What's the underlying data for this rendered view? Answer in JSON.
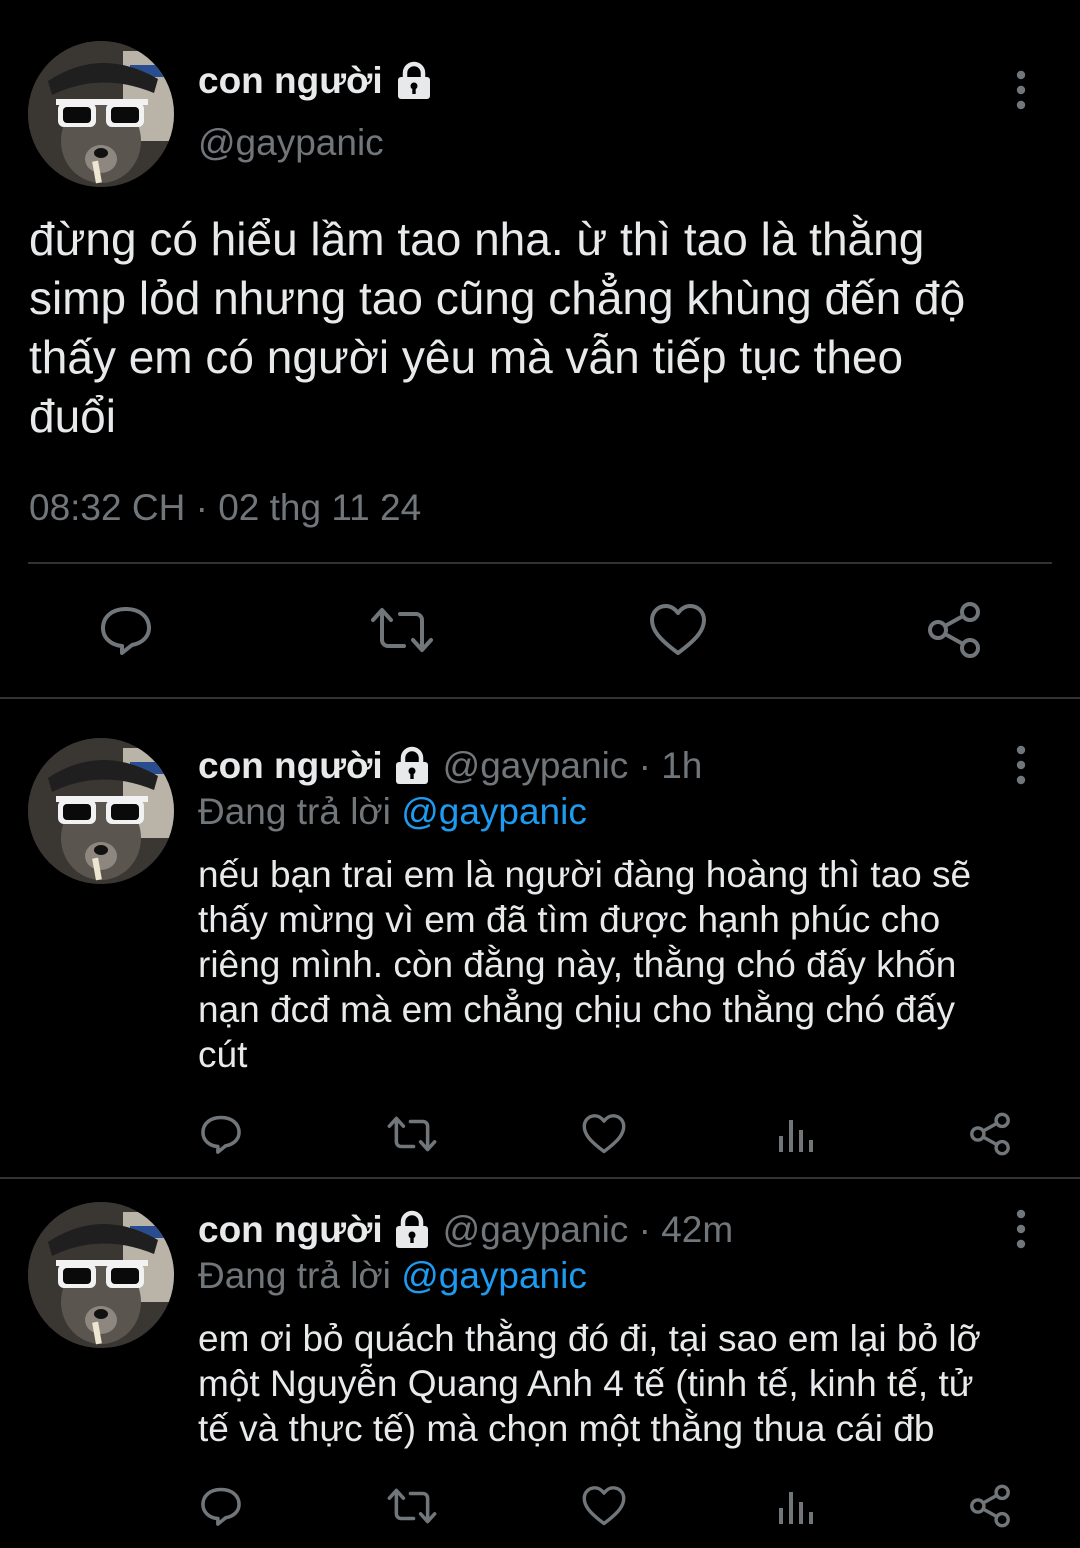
{
  "main_tweet": {
    "author_name": "con người",
    "handle": "@gaypanic",
    "text": "đừng có hiểu lầm tao nha. ừ thì tao là thằng\nsimp lỏd nhưng tao cũng chẳng khùng đến độ\nthấy em có người yêu mà vẫn tiếp tục theo\nđuổi",
    "timestamp": "08:32 CH · 02 thg 11 24",
    "icons": {
      "lock": "lock-icon",
      "more": "more-vertical-icon",
      "reply": "reply-icon",
      "retweet": "retweet-icon",
      "like": "heart-icon",
      "share": "share-icon"
    }
  },
  "replies": [
    {
      "author_name": "con người",
      "handle": "@gaypanic",
      "time_ago": "1h",
      "replying_label": "Đang trả lời",
      "replying_to": "@gaypanic",
      "text": "nếu bạn trai em là người đàng hoàng thì tao sẽ\nthấy mừng vì em đã tìm được hạnh phúc cho\nriêng mình. còn đằng này, thằng chó đấy khốn\nnạn đcđ mà em chẳng chịu cho thằng chó đấy\ncút"
    },
    {
      "author_name": "con người",
      "handle": "@gaypanic",
      "time_ago": "42m",
      "replying_label": "Đang trả lời",
      "replying_to": "@gaypanic",
      "text": "em ơi bỏ quách thằng đó đi, tại sao em lại bỏ lỡ\nmột Nguyễn Quang Anh 4 tế (tinh tế, kinh tế, tử\ntế và thực tế) mà chọn một thằng thua cái đb"
    }
  ],
  "colors": {
    "background": "#000000",
    "text_primary": "#e7e9ea",
    "text_secondary": "#71767b",
    "mention": "#1d9bf0",
    "divider": "#2f3336"
  },
  "avatar_icon": "raccoon-sunglasses-avatar"
}
